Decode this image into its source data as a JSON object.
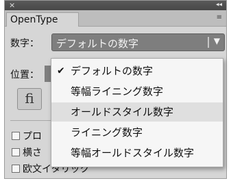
{
  "titlebar": {
    "close_glyph": "×",
    "collapse_glyph": "◂◂"
  },
  "tab": {
    "label": "OpenType",
    "menu_glyph": "≡"
  },
  "numerals": {
    "label": "数字：",
    "value": "デフォルトの数字",
    "arrow_glyph": "▼"
  },
  "position": {
    "label": "位置："
  },
  "fi_button": {
    "label": "fi"
  },
  "checkboxes": [
    {
      "label": "プロ",
      "checked": false
    },
    {
      "label": "横さ",
      "checked": false
    },
    {
      "label": "欧文イタリック",
      "checked": false
    }
  ],
  "dropdown": {
    "check_glyph": "✔",
    "options": [
      {
        "label": "デフォルトの数字",
        "checked": true,
        "highlighted": false
      },
      {
        "label": "等幅ライニング数字",
        "checked": false,
        "highlighted": false
      },
      {
        "label": "オールドスタイル数字",
        "checked": false,
        "highlighted": true
      },
      {
        "label": "ライニング数字",
        "checked": false,
        "highlighted": false
      },
      {
        "label": "等幅オールドスタイル数字",
        "checked": false,
        "highlighted": false
      }
    ]
  },
  "colors": {
    "panel_bg": "#d6d6d6",
    "select_bg": "#7e7e7e",
    "dropdown_bg": "#f6f6f6",
    "highlight_bg": "#dfdfdf"
  }
}
